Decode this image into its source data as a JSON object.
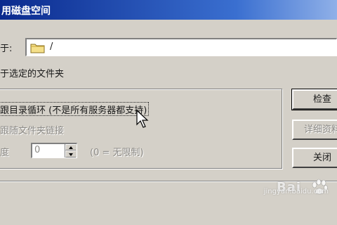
{
  "window": {
    "title": "用磁盘空间"
  },
  "location": {
    "label": "于:",
    "path": "/",
    "icon": "folder-icon"
  },
  "scope_text": "于选定的文件夹",
  "options": {
    "loop_checkbox_label": "跟目录循环 (不是所有服务器都支持)",
    "follow_links_label": "跟随文件夹链接",
    "depth_label": "度",
    "depth_value": "0",
    "depth_hint": "(0 = 无限制)"
  },
  "buttons": {
    "check": "检查",
    "details": "详细资料",
    "close": "关闭"
  },
  "watermark": {
    "text": "Bai",
    "url": "jingyan.baidu.com"
  },
  "colors": {
    "title_bar": "#0a2a8e",
    "dialog_bg": "#d4d0c8"
  }
}
